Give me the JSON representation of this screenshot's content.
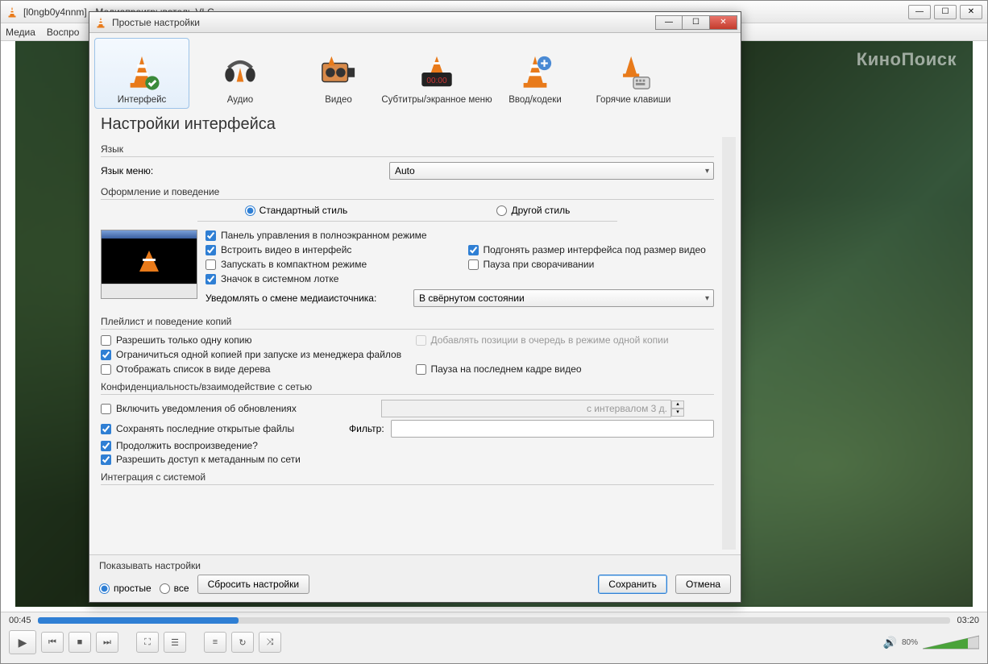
{
  "mainWindow": {
    "title": "[l0ngb0y4nnm] - Медиапроигрыватель VLC",
    "menu": {
      "media": "Медиа",
      "playback": "Воспро"
    },
    "watermark": "КиноПоиск",
    "time": {
      "current": "00:45",
      "total": "03:20"
    },
    "volume": "80%"
  },
  "dialog": {
    "title": "Простые настройки",
    "categories": {
      "interface": "Интерфейс",
      "audio": "Аудио",
      "video": "Видео",
      "subtitles": "Субтитры/экранное меню",
      "input": "Ввод/кодеки",
      "hotkeys": "Горячие клавиши"
    },
    "heading": "Настройки интерфейса",
    "sections": {
      "language": {
        "title": "Язык",
        "menuLangLabel": "Язык меню:",
        "menuLangValue": "Auto"
      },
      "look": {
        "title": "Оформление и поведение",
        "styleStd": "Стандартный стиль",
        "styleOther": "Другой стиль",
        "fullscreenToolbar": "Панель управления в полноэкранном режиме",
        "embedVideo": "Встроить видео в интерфейс",
        "resizeToVideo": "Подгонять размер интерфейса под размер видео",
        "startMinimal": "Запускать в компактном режиме",
        "pauseOnMin": "Пауза при сворачивании",
        "systray": "Значок в системном лотке",
        "notifyChangeLabel": "Уведомлять о смене медиаисточника:",
        "notifyChangeValue": "В свёрнутом состоянии"
      },
      "playlist": {
        "title": "Плейлист и поведение копий",
        "oneInstance": "Разрешить только одну копию",
        "enqueueOne": "Добавлять позиции в очередь в режиме одной копии",
        "oneFromFilemgr": "Ограничиться одной копией при запуске из менеджера файлов",
        "treeView": "Отображать список в виде дерева",
        "pauseLastFrame": "Пауза на последнем кадре видео"
      },
      "privacy": {
        "title": "Конфиденциальность/взаимодействие с сетью",
        "updateNotify": "Включить уведомления об обновлениях",
        "updateInterval": "с интервалом 3 д.",
        "saveRecent": "Сохранять последние открытые файлы",
        "filterLabel": "Фильтр:",
        "continuePlayback": "Продолжить воспроизведение?",
        "metadataNet": "Разрешить доступ к метаданным по сети"
      },
      "sysIntegration": {
        "title": "Интеграция с системой"
      }
    },
    "bottom": {
      "showSettings": "Показывать настройки",
      "simple": "простые",
      "all": "все",
      "reset": "Сбросить настройки",
      "save": "Сохранить",
      "cancel": "Отмена"
    }
  }
}
